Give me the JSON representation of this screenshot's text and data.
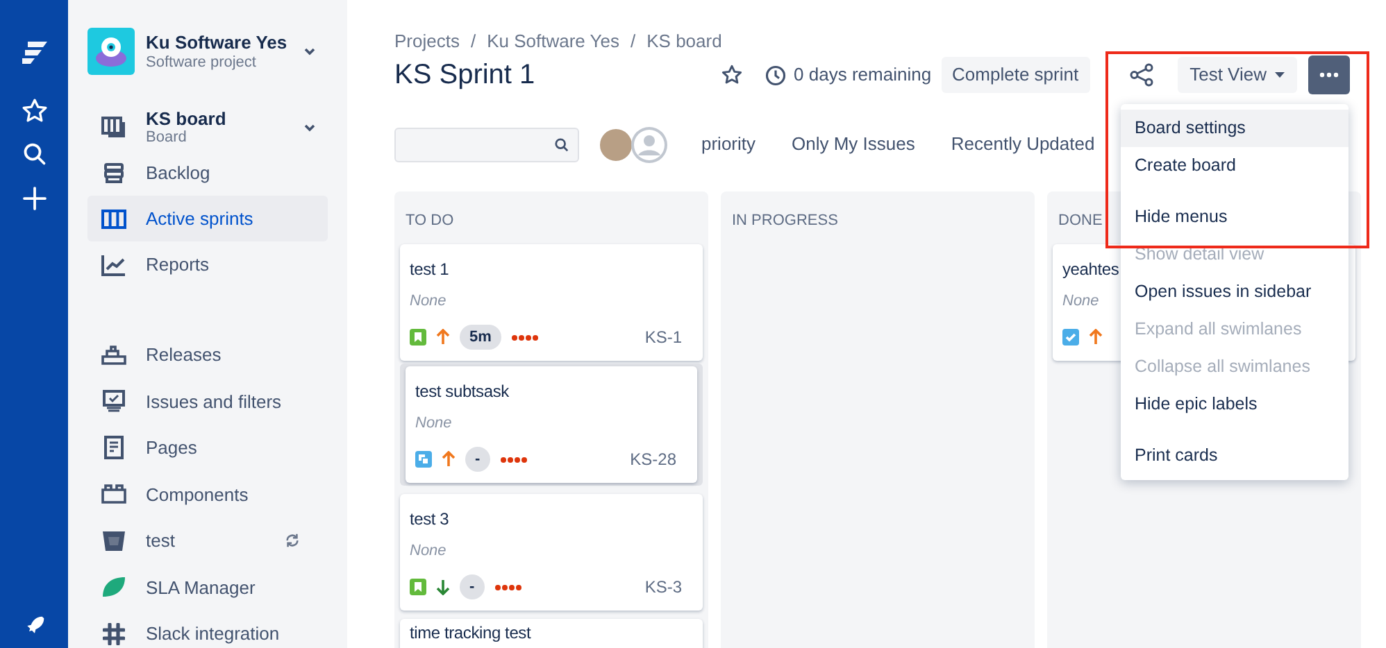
{
  "project": {
    "name": "Ku Software Yes",
    "type": "Software project"
  },
  "board": {
    "name": "KS board",
    "type": "Board"
  },
  "nav_items": [
    {
      "label": "Backlog",
      "selected": false
    },
    {
      "label": "Active sprints",
      "selected": true
    },
    {
      "label": "Reports",
      "selected": false
    }
  ],
  "shortcuts": [
    {
      "label": "Releases",
      "syncing": false
    },
    {
      "label": "Issues and filters",
      "syncing": false
    },
    {
      "label": "Pages",
      "syncing": false
    },
    {
      "label": "Components",
      "syncing": false
    },
    {
      "label": "test",
      "syncing": true
    },
    {
      "label": "SLA Manager",
      "syncing": false
    },
    {
      "label": "Slack integration",
      "syncing": false
    }
  ],
  "breadcrumbs": [
    "Projects",
    "/",
    "Ku Software Yes",
    "/",
    "KS board"
  ],
  "title": "KS Sprint 1",
  "remaining": "0 days remaining",
  "complete_button": "Complete sprint",
  "view_button": "Test View",
  "quick_filters": [
    "priority",
    "Only My Issues",
    "Recently Updated"
  ],
  "columns": [
    {
      "title": "TO DO",
      "cards": [
        {
          "title": "test 1",
          "epic": "None",
          "kind": "story",
          "raised": true,
          "estimate": "5m",
          "key": "KS-1"
        },
        {
          "title": "test subtsask",
          "epic": "None",
          "kind": "subtask",
          "raised": true,
          "estimate": "-",
          "key": "KS-28"
        },
        {
          "title": "test 3",
          "epic": "None",
          "kind": "story",
          "raised": false,
          "estimate": "-",
          "key": "KS-3"
        },
        {
          "title": "time tracking test"
        }
      ]
    },
    {
      "title": "IN PROGRESS"
    },
    {
      "title": "DONE",
      "cards": [
        {
          "title": "yeahtes",
          "epic": "None",
          "kind": "task",
          "raised": true
        }
      ]
    }
  ],
  "menu_groups": [
    [
      {
        "label": "Board settings",
        "highlighted": true,
        "disabled": false
      },
      {
        "label": "Create board",
        "highlighted": false,
        "disabled": false
      }
    ],
    [
      {
        "label": "Hide menus",
        "highlighted": false,
        "disabled": false
      },
      {
        "label": "Show detail view",
        "highlighted": false,
        "disabled": true
      },
      {
        "label": "Open issues in sidebar",
        "highlighted": false,
        "disabled": false
      },
      {
        "label": "Expand all swimlanes",
        "highlighted": false,
        "disabled": true
      },
      {
        "label": "Collapse all swimlanes",
        "highlighted": false,
        "disabled": true
      },
      {
        "label": "Hide epic labels",
        "highlighted": false,
        "disabled": false
      }
    ],
    [
      {
        "label": "Print cards",
        "highlighted": false,
        "disabled": false
      }
    ]
  ]
}
